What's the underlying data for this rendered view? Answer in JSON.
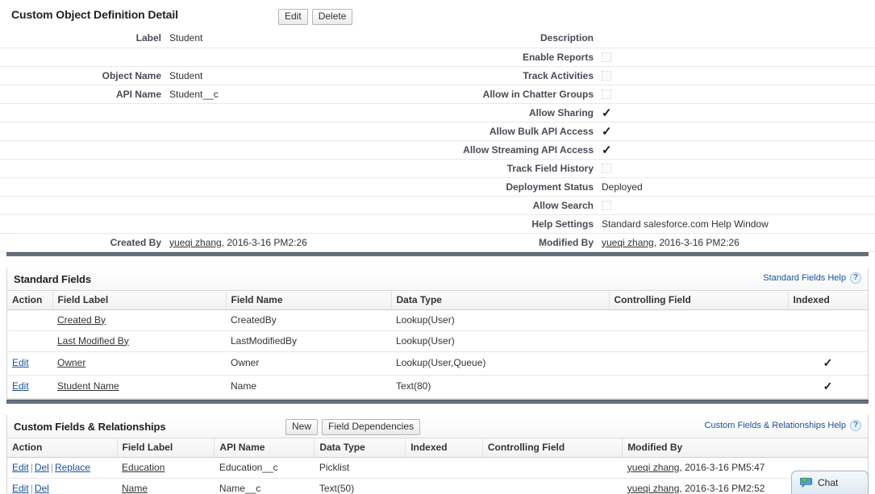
{
  "detail": {
    "title": "Custom Object Definition Detail",
    "buttons": [
      {
        "label": "Edit",
        "name": "edit-button"
      },
      {
        "label": "Delete",
        "name": "delete-button"
      }
    ],
    "rows": [
      {
        "left_label": "Label",
        "left_value": "Student",
        "left_type": "text",
        "right_label": "Description",
        "right_value": "",
        "right_type": "text"
      },
      {
        "left_label": "",
        "left_value": "",
        "left_type": "blank",
        "right_label": "Enable Reports",
        "right_value": "unchecked",
        "right_type": "checkbox"
      },
      {
        "left_label": "Object Name",
        "left_value": "Student",
        "left_type": "text",
        "right_label": "Track Activities",
        "right_value": "unchecked",
        "right_type": "checkbox"
      },
      {
        "left_label": "API Name",
        "left_value": "Student__c",
        "left_type": "text",
        "right_label": "Allow in Chatter Groups",
        "right_value": "unchecked",
        "right_type": "checkbox"
      },
      {
        "left_label": "",
        "left_value": "",
        "left_type": "blank",
        "right_label": "Allow Sharing",
        "right_value": "checked",
        "right_type": "checkbox"
      },
      {
        "left_label": "",
        "left_value": "",
        "left_type": "blank",
        "right_label": "Allow Bulk API Access",
        "right_value": "checked",
        "right_type": "checkbox"
      },
      {
        "left_label": "",
        "left_value": "",
        "left_type": "blank",
        "right_label": "Allow Streaming API Access",
        "right_value": "checked",
        "right_type": "checkbox"
      },
      {
        "left_label": "",
        "left_value": "",
        "left_type": "blank",
        "right_label": "Track Field History",
        "right_value": "unchecked",
        "right_type": "checkbox"
      },
      {
        "left_label": "",
        "left_value": "",
        "left_type": "blank",
        "right_label": "Deployment Status",
        "right_value": "Deployed",
        "right_type": "text"
      },
      {
        "left_label": "",
        "left_value": "",
        "left_type": "blank",
        "right_label": "Allow Search",
        "right_value": "unchecked",
        "right_type": "checkbox"
      },
      {
        "left_label": "",
        "left_value": "",
        "left_type": "blank",
        "right_label": "Help Settings",
        "right_value": "Standard salesforce.com Help Window",
        "right_type": "text"
      },
      {
        "left_label": "Created By",
        "left_value": "yueqi zhang",
        "left_suffix": ", 2016-3-16 PM2:26",
        "left_type": "userlink",
        "right_label": "Modified By",
        "right_value": "yueqi zhang",
        "right_suffix": ", 2016-3-16 PM2:26",
        "right_type": "userlink"
      }
    ]
  },
  "standard_fields": {
    "title": "Standard Fields",
    "help_link": "Standard Fields Help",
    "help_icon": "question-mark-icon",
    "columns": [
      "Action",
      "Field Label",
      "Field Name",
      "Data Type",
      "Controlling Field",
      "Indexed"
    ],
    "rows": [
      {
        "actions": [],
        "field_label": "Created By",
        "field_name": "CreatedBy",
        "data_type": "Lookup(User)",
        "controlling_field": "",
        "indexed": ""
      },
      {
        "actions": [],
        "field_label": "Last Modified By",
        "field_name": "LastModifiedBy",
        "data_type": "Lookup(User)",
        "controlling_field": "",
        "indexed": ""
      },
      {
        "actions": [
          "Edit"
        ],
        "field_label": "Owner",
        "field_name": "Owner",
        "data_type": "Lookup(User,Queue)",
        "controlling_field": "",
        "indexed": "✓"
      },
      {
        "actions": [
          "Edit"
        ],
        "field_label": "Student Name",
        "field_name": "Name",
        "data_type": "Text(80)",
        "controlling_field": "",
        "indexed": "✓"
      }
    ]
  },
  "custom_fields": {
    "title": "Custom Fields & Relationships",
    "buttons": [
      {
        "label": "New",
        "name": "new-field-button"
      },
      {
        "label": "Field Dependencies",
        "name": "field-dependencies-button"
      }
    ],
    "help_link": "Custom Fields & Relationships Help",
    "help_icon": "question-mark-icon",
    "columns": [
      "Action",
      "Field Label",
      "API Name",
      "Data Type",
      "Indexed",
      "Controlling Field",
      "Modified By"
    ],
    "rows": [
      {
        "actions": [
          "Edit",
          "Del",
          "Replace"
        ],
        "field_label": "Education",
        "api_name": "Education__c",
        "data_type": "Picklist",
        "indexed": "",
        "controlling_field": "",
        "modified_by_user": "yueqi zhang",
        "modified_by_date": ", 2016-3-16 PM5:47"
      },
      {
        "actions": [
          "Edit",
          "Del"
        ],
        "field_label": "Name",
        "api_name": "Name__c",
        "data_type": "Text(50)",
        "indexed": "",
        "controlling_field": "",
        "modified_by_user": "yueqi zhang",
        "modified_by_date": ", 2016-3-16 PM2:52"
      }
    ]
  },
  "chat": {
    "label": "Chat",
    "icon": "chat-bubble-icon"
  },
  "colors": {
    "link": "#1b5297",
    "section_bar": "#67707e",
    "label_text": "#4a4a56"
  }
}
